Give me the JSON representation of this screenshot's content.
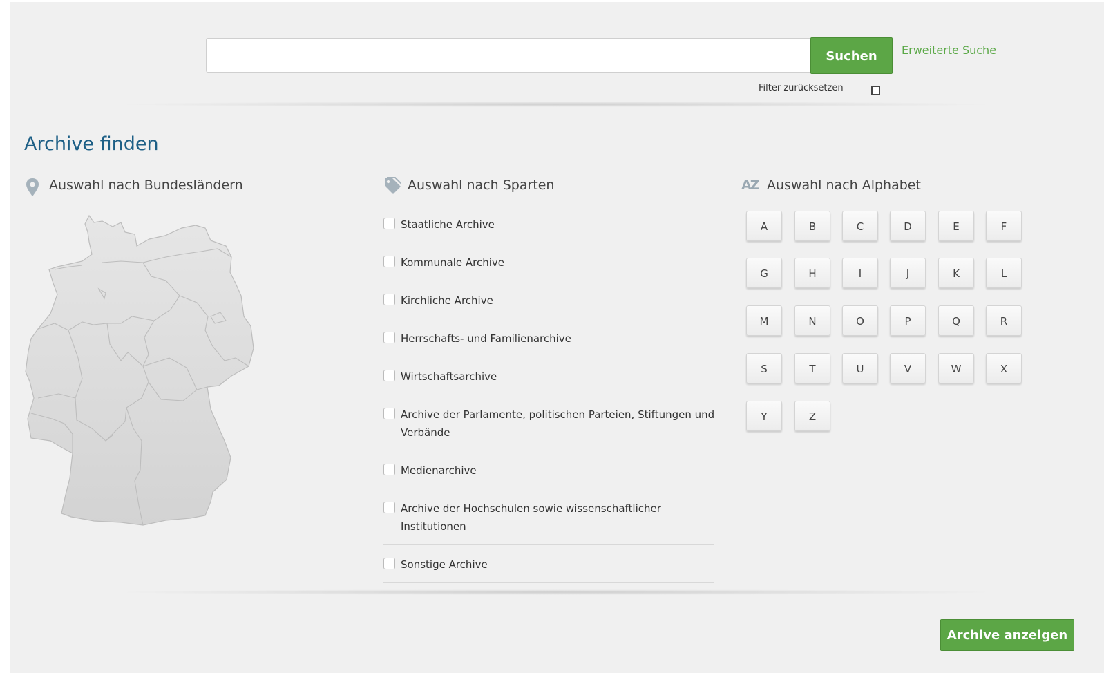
{
  "search": {
    "input_value": "",
    "button_label": "Suchen",
    "advanced_link": "Erweiterte Suche",
    "reset_filter_label": "Filter zurücksetzen",
    "reset_filter_checked": false
  },
  "page_title": "Archive finden",
  "columns": {
    "states": {
      "heading": "Auswahl nach Bundesländern",
      "icon": "map-pin-icon"
    },
    "divisions": {
      "heading": "Auswahl nach Sparten",
      "icon": "tag-icon",
      "items": [
        {
          "label": "Staatliche Archive",
          "checked": false
        },
        {
          "label": "Kommunale Archive",
          "checked": false
        },
        {
          "label": "Kirchliche Archive",
          "checked": false
        },
        {
          "label": "Herrschafts- und Familienarchive",
          "checked": false
        },
        {
          "label": "Wirtschaftsarchive",
          "checked": false
        },
        {
          "label": "Archive der Parlamente, politischen Parteien, Stiftungen und Verbände",
          "checked": false
        },
        {
          "label": "Medienarchive",
          "checked": false
        },
        {
          "label": "Archive der Hochschulen sowie wissenschaftlicher Institutionen",
          "checked": false
        },
        {
          "label": "Sonstige Archive",
          "checked": false
        }
      ]
    },
    "alphabet": {
      "heading": "Auswahl nach Alphabet",
      "icon": "az-sort-icon",
      "icon_text": "AZ",
      "letters": [
        "A",
        "B",
        "C",
        "D",
        "E",
        "F",
        "G",
        "H",
        "I",
        "J",
        "K",
        "L",
        "M",
        "N",
        "O",
        "P",
        "Q",
        "R",
        "S",
        "T",
        "U",
        "V",
        "W",
        "X",
        "Y",
        "Z"
      ]
    }
  },
  "submit_button": "Archive anzeigen",
  "colors": {
    "accent_green": "#5ca646",
    "title_blue": "#1d5f86",
    "panel_bg": "#f0f0f0"
  }
}
